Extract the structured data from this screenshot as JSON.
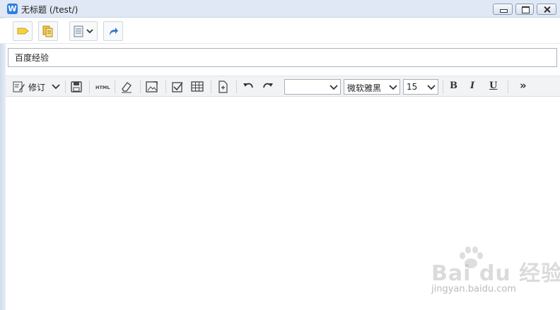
{
  "window": {
    "title": "无标题 (/test/)",
    "app_icon_letter": "W",
    "controls": [
      "minimize-icon",
      "maximize-icon",
      "close-icon"
    ]
  },
  "top_toolbar": {
    "buttons": [
      "tag-icon",
      "notebook-icon",
      "document-list-icon",
      "share-icon"
    ]
  },
  "note": {
    "title_value": "百度经验"
  },
  "editor_toolbar": {
    "revise_label": "修订",
    "paragraph_style_value": "",
    "font_family_value": "微软雅黑",
    "font_size_value": "15",
    "bold_label": "B",
    "italic_label": "I",
    "underline_label": "U",
    "more_label": "»"
  },
  "watermark": {
    "brand": "Bai du 经验",
    "url": "jingyan.baidu.com"
  },
  "colors": {
    "titlebar": "#dfe8f4",
    "toolbar_bg": "#f2f3f5",
    "accent_blue": "#2f7fe0",
    "tag_yellow": "#f5d142"
  }
}
